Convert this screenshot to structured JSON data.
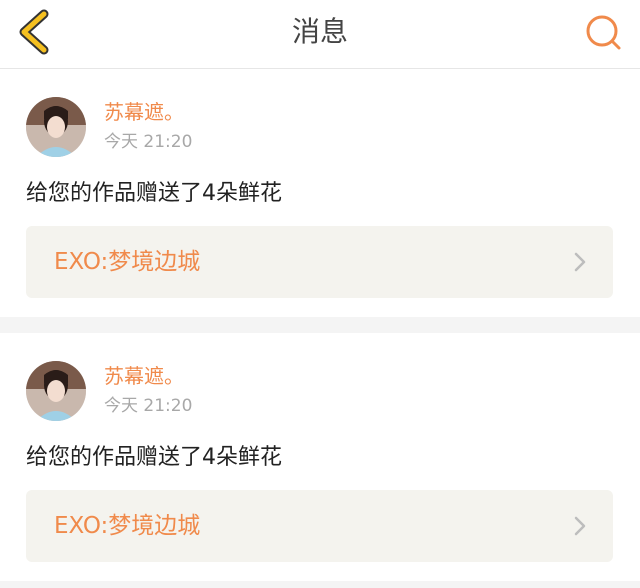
{
  "header": {
    "title": "消息",
    "back_icon": "chevron-left-icon",
    "search_icon": "search-icon"
  },
  "colors": {
    "accent": "#f08a4b",
    "header_icon": "#f5c020",
    "link_bg": "#f4f3ee",
    "page_bg": "#f4f4f4"
  },
  "notifications": [
    {
      "user": "苏幕遮。",
      "time": "今天 21:20",
      "message": "给您的作品赠送了4朵鲜花",
      "work_title": "EXO:梦境边城"
    },
    {
      "user": "苏幕遮。",
      "time": "今天 21:20",
      "message": "给您的作品赠送了4朵鲜花",
      "work_title": "EXO:梦境边城"
    }
  ]
}
